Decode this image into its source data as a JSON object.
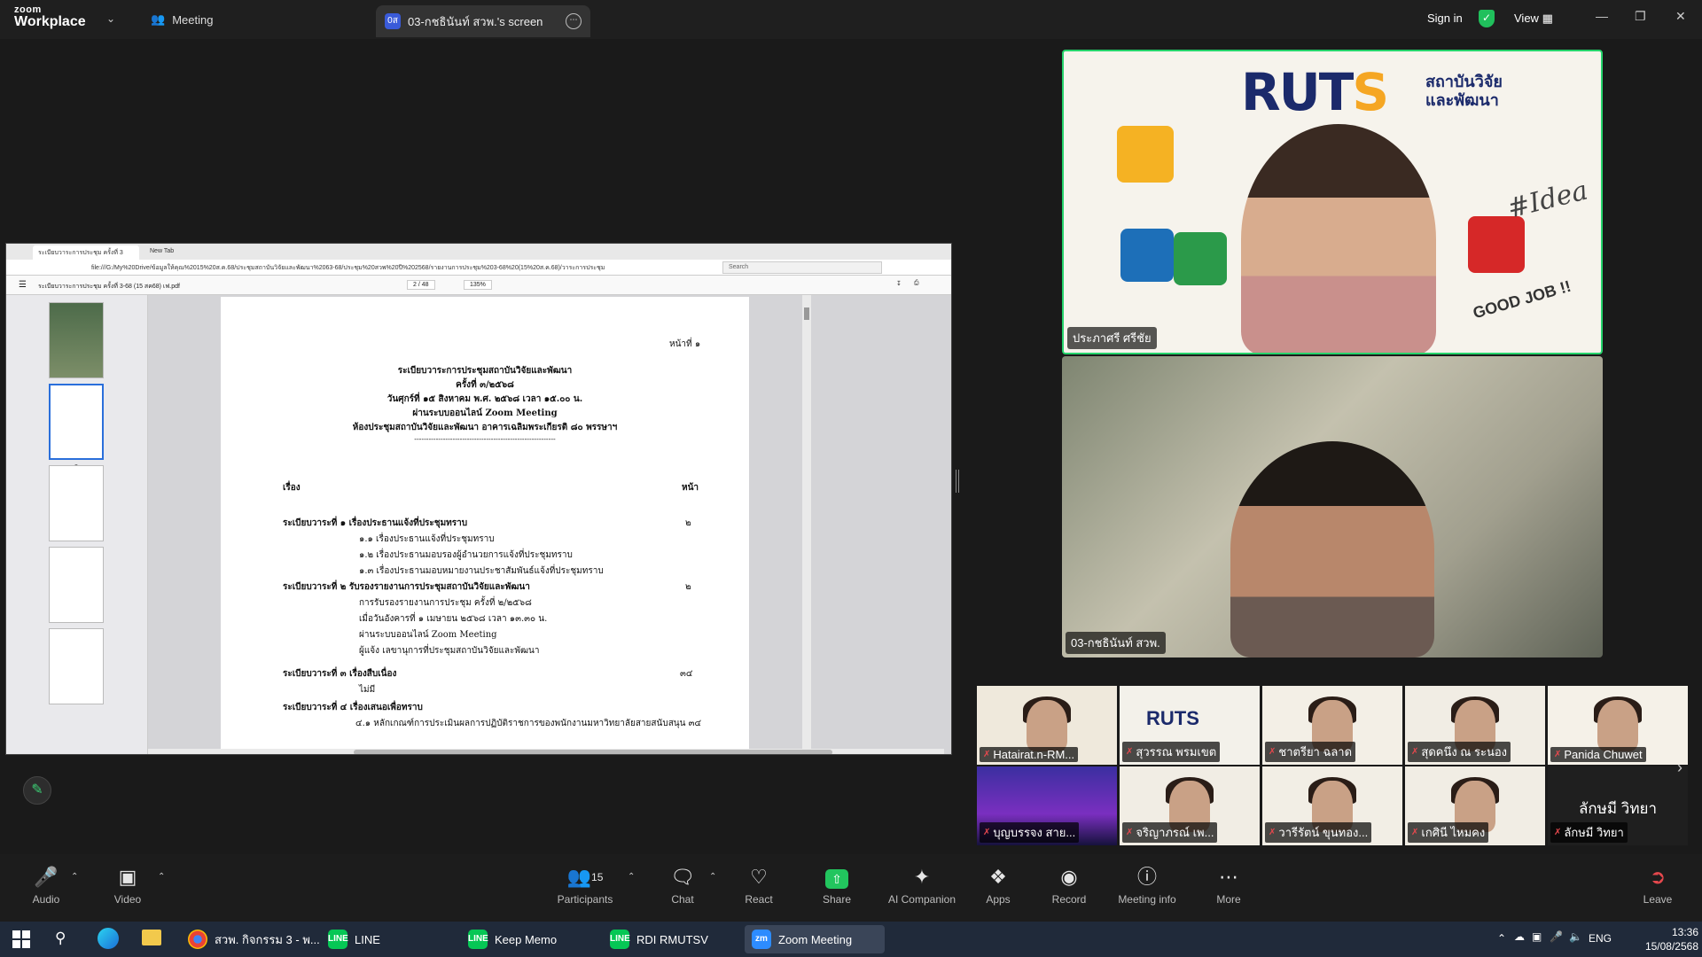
{
  "app": {
    "brand_line1": "zoom",
    "brand_line2": "Workplace",
    "meeting_label": "Meeting",
    "screen_tab_badge": "0ส",
    "screen_tab_label": "03-กชธินันท์  สวพ.'s screen",
    "sign_in": "Sign in",
    "view": "View"
  },
  "browser": {
    "tab1": "ระเบียบวาระการประชุม ครั้งที่ 3",
    "tab2": "New Tab",
    "address": "file:///G:/My%20Drive/ข้อมูลให้คุณ%2015%20ส.ค.68/ประชุมสถาบันวิจัยและพัฒนา%2063-68/ประชุม%20สวพ%20ปี%202568/รายงานการประชุม%203-68%20(15%20ส.ค.68)/วาระการประชุม",
    "search_placeholder": "Search",
    "pdf_name": "ระเบียบวาระการประชุม ครั้งที่ 3-68 (15 สค68) เฟ.pdf",
    "page_indicator": "2 / 48",
    "zoom_level": "135%",
    "thumb_numbers": [
      "1",
      "2",
      "3",
      "4"
    ]
  },
  "document": {
    "page_no": "หน้าที่ ๑",
    "header": [
      "ระเบียบวาระการประชุมสถาบันวิจัยและพัฒนา",
      "ครั้งที่ ๓/๒๕๖๘",
      "วันศุกร์ที่ ๑๕ สิงหาคม  พ.ศ. ๒๕๖๘  เวลา ๑๕.๐๐ น.",
      "ผ่านระบบออนไลน์  Zoom Meeting",
      "ห้องประชุมสถาบันวิจัยและพัฒนา   อาคารเฉลิมพระเกียรติ ๘๐ พรรษาฯ"
    ],
    "rule": "-----------------------------------------------------------",
    "col_subject": "เรื่อง",
    "col_page": "หน้า",
    "agenda1_head": "ระเบียบวาระที่ ๑  เรื่องประธานแจ้งที่ประชุมทราบ",
    "agenda1_page": "๒",
    "agenda1_items": [
      "๑.๑ เรื่องประธานแจ้งที่ประชุมทราบ",
      "๑.๒ เรื่องประธานมอบรองผู้อำนวยการแจ้งที่ประชุมทราบ",
      "๑.๓ เรื่องประธานมอบหมายงานประชาสัมพันธ์แจ้งที่ประชุมทราบ"
    ],
    "agenda2_head": "ระเบียบวาระที่ ๒  รับรองรายงานการประชุมสถาบันวิจัยและพัฒนา",
    "agenda2_page": "๒",
    "agenda2_items": [
      "การรับรองรายงานการประชุม  ครั้งที่ ๒/๒๕๖๘",
      "เมื่อวันอังคารที่ ๑ เมษายน ๒๕๖๘  เวลา ๑๓.๓๐ น.",
      "ผ่านระบบออนไลน์  Zoom Meeting",
      "ผู้แจ้ง  เลขานุการที่ประชุมสถาบันวิจัยและพัฒนา"
    ],
    "agenda3_head": "ระเบียบวาระที่ ๓  เรื่องสืบเนื่อง",
    "agenda3_page": "๓๔",
    "agenda3_items": [
      "ไม่มี"
    ],
    "agenda4_head": "ระเบียบวาระที่ ๔  เรื่องเสนอเพื่อทราบ",
    "agenda4_items": [
      "๔.๑ หลักเกณฑ์การประเมินผลการปฏิบัติราชการของพนักงานมหาวิทยาลัยสายสนับสนุน ๓๔"
    ]
  },
  "speakers": {
    "tile1_name": "ประภาศรี ศรีชัย",
    "tile1_logo": "RUT",
    "tile1_logo_s": "S",
    "tile1_logo_sub1": "สถาบันวิจัย",
    "tile1_logo_sub2": "และพัฒนา",
    "tile1_hashtag": "#Idea",
    "tile1_goodjob": "GOOD JOB !!",
    "tile2_name": "03-กชธินันท์  สวพ."
  },
  "participants": [
    {
      "name": "Hatairat.n-RM..."
    },
    {
      "name": "สุวรรณ พรมเขต"
    },
    {
      "name": "ชาตรียา ฉลาด"
    },
    {
      "name": "สุดคนึง ณ ระนอง"
    },
    {
      "name": "Panida Chuwet"
    },
    {
      "name": "บุญบรรจง สาย..."
    },
    {
      "name": "จริญาภรณ์  เพ..."
    },
    {
      "name": "วารีรัตน์ ขุนทอง..."
    },
    {
      "name": "เกศินี ไหมคง"
    },
    {
      "name": "ลักษมี วิทยา",
      "display": "ลักษมี วิทยา"
    }
  ],
  "toolbar": {
    "audio": "Audio",
    "video": "Video",
    "participants": "Participants",
    "participants_count": "15",
    "chat": "Chat",
    "react": "React",
    "share": "Share",
    "ai": "AI Companion",
    "apps": "Apps",
    "record": "Record",
    "info": "Meeting info",
    "more": "More",
    "leave": "Leave"
  },
  "taskbar": {
    "chrome": "สวพ. กิจกรรม 3 - พ...",
    "line": "LINE",
    "keep": "Keep Memo",
    "rdi": "RDI RMUTSV",
    "zoom": "Zoom Meeting",
    "lang": "ENG",
    "time": "13:36",
    "date": "15/08/2568"
  },
  "colors": {
    "accent_green": "#25d36b",
    "mute_red": "#e5484d",
    "rmuts_navy": "#1b2a6b",
    "rmuts_orange": "#f5a623"
  }
}
